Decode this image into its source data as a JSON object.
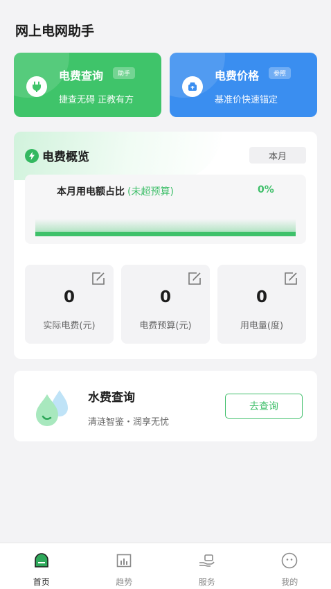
{
  "app": {
    "title": "网上电网助手"
  },
  "cards": [
    {
      "title": "电费查询",
      "tag": "助手",
      "subtitle": "捷查无碍 正教有方",
      "icon": "plug-icon",
      "color": "#3fc46a"
    },
    {
      "title": "电费价格",
      "tag": "参照",
      "subtitle": "基准价快速锚定",
      "icon": "price-tag-icon",
      "color": "#3a8ef0"
    }
  ],
  "overview": {
    "title": "电费概览",
    "period": "本月",
    "ratio_label": "本月用电额占比",
    "ratio_hint": "(未超预算)",
    "ratio_value": "0%",
    "ratio_fraction": 0,
    "stats": [
      {
        "value": "0",
        "label": "实际电费(元)"
      },
      {
        "value": "0",
        "label": "电费预算(元)"
      },
      {
        "value": "0",
        "label": "用电量(度)"
      }
    ]
  },
  "water": {
    "title": "水费查询",
    "subtitle": "清涟智鉴・润享无忧",
    "button": "去查询",
    "icon": "water-drop-icon"
  },
  "nav": [
    {
      "label": "首页",
      "icon": "home-icon",
      "active": true
    },
    {
      "label": "趋势",
      "icon": "trend-chart-icon",
      "active": false
    },
    {
      "label": "服务",
      "icon": "service-hand-icon",
      "active": false
    },
    {
      "label": "我的",
      "icon": "profile-face-icon",
      "active": false
    }
  ],
  "colors": {
    "primary_green": "#3fc46a",
    "primary_blue": "#3a8ef0",
    "background": "#f3f3f5"
  }
}
